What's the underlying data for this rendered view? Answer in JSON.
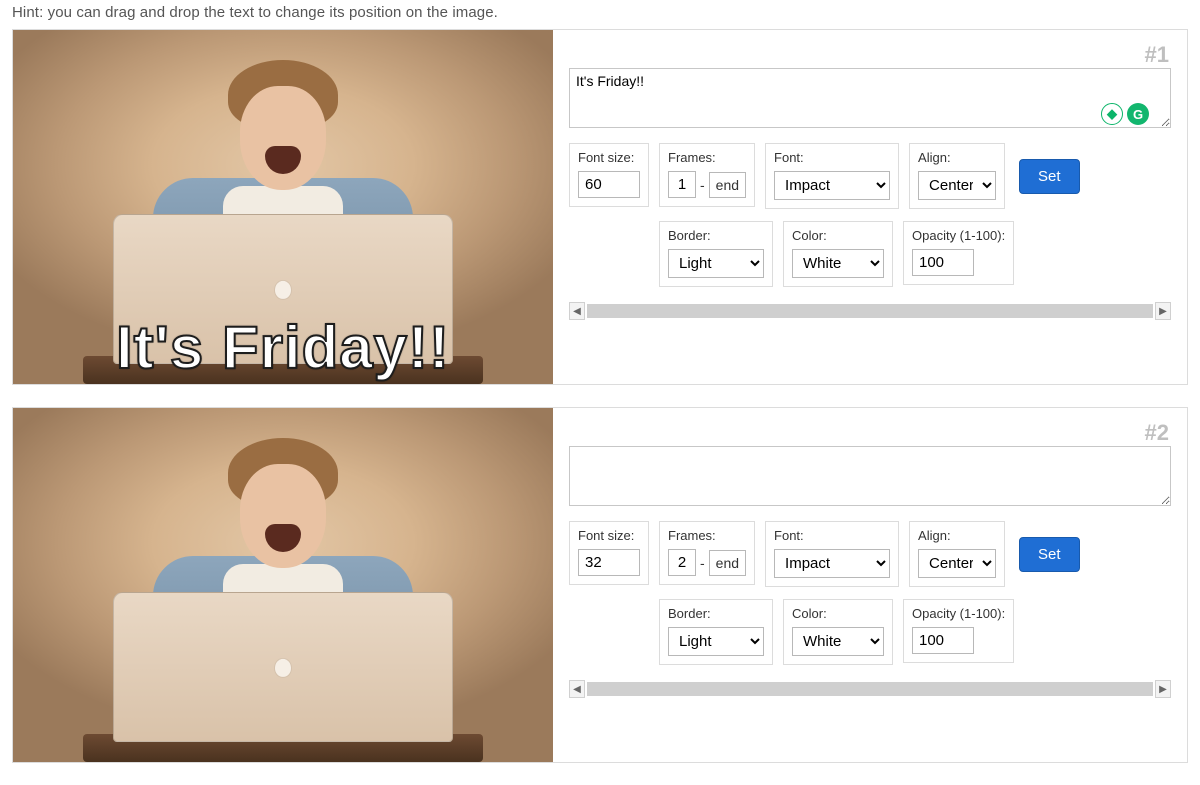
{
  "hint": "Hint: you can drag and drop the text to change its position on the image.",
  "labels": {
    "font_size": "Font size:",
    "frames": "Frames:",
    "frames_end": "end",
    "font": "Font:",
    "align": "Align:",
    "border": "Border:",
    "color": "Color:",
    "opacity": "Opacity (1-100):",
    "set": "Set"
  },
  "options": {
    "font": [
      "Impact"
    ],
    "align": [
      "Center"
    ],
    "border": [
      "Light"
    ],
    "color": [
      "White"
    ]
  },
  "panels": [
    {
      "index": "#1",
      "caption_text": "It's Friday!!",
      "textarea_value": "It's Friday!!",
      "font_size": "60",
      "frame_start": "1",
      "frame_end": "end",
      "font": "Impact",
      "align": "Center",
      "border": "Light",
      "color": "White",
      "opacity": "100",
      "show_helper_icons": true
    },
    {
      "index": "#2",
      "caption_text": "",
      "textarea_value": "",
      "font_size": "32",
      "frame_start": "2",
      "frame_end": "end",
      "font": "Impact",
      "align": "Center",
      "border": "Light",
      "color": "White",
      "opacity": "100",
      "show_helper_icons": false
    }
  ]
}
